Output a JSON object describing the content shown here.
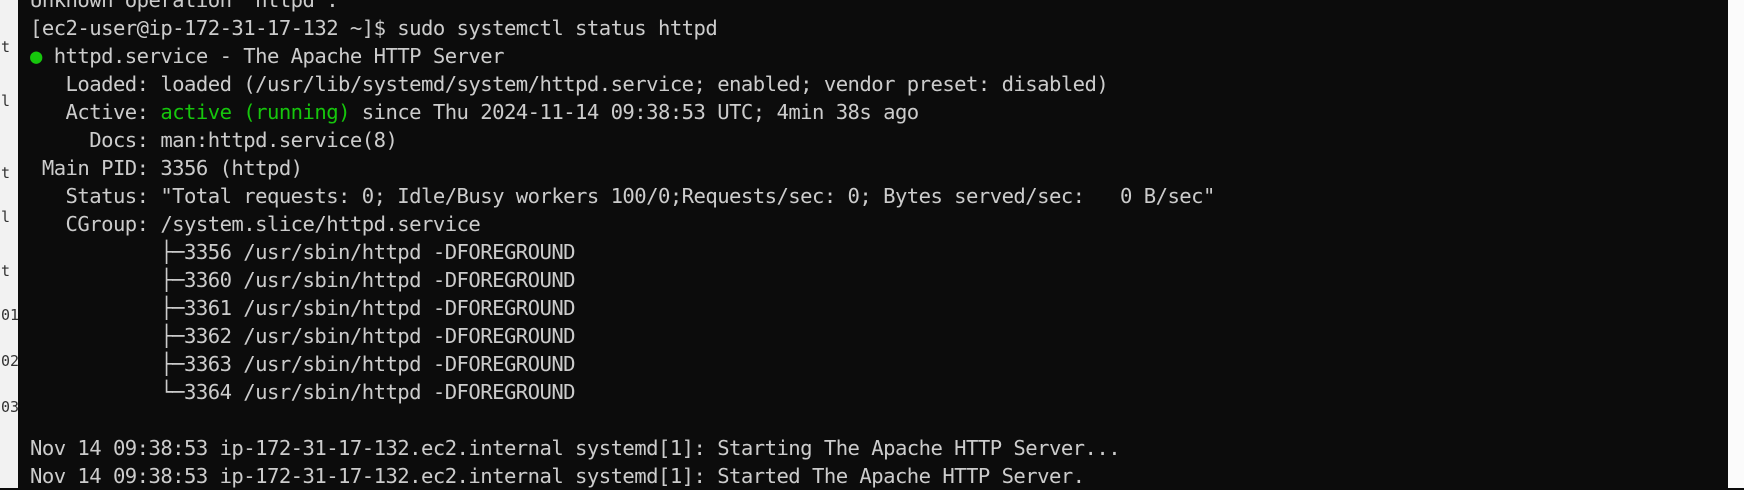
{
  "colors": {
    "background": "#0c0c0c",
    "foreground": "#cccccc",
    "active_green": "#16c60c"
  },
  "left_strip_fragments": [
    "t",
    "l",
    "t",
    "l",
    "t",
    "01",
    "02",
    "03"
  ],
  "terminal": {
    "top_partial": "Unknown operation 'httpd'.",
    "prompt": "[ec2-user@ip-172-31-17-132 ~]$ sudo systemctl status httpd",
    "status_dot": "●",
    "unit_title": " httpd.service - The Apache HTTP Server",
    "loaded": "   Loaded: loaded (/usr/lib/systemd/system/httpd.service; enabled; vendor preset: disabled)",
    "active_prefix": "   Active: ",
    "active_state": "active (running)",
    "active_suffix": " since Thu 2024-11-14 09:38:53 UTC; 4min 38s ago",
    "docs": "     Docs: man:httpd.service(8)",
    "main_pid": " Main PID: 3356 (httpd)",
    "status": "   Status: \"Total requests: 0; Idle/Busy workers 100/0;Requests/sec: 0; Bytes served/sec:   0 B/sec\"",
    "cgroup": "   CGroup: /system.slice/httpd.service",
    "processes": [
      "           ├─3356 /usr/sbin/httpd -DFOREGROUND",
      "           ├─3360 /usr/sbin/httpd -DFOREGROUND",
      "           ├─3361 /usr/sbin/httpd -DFOREGROUND",
      "           ├─3362 /usr/sbin/httpd -DFOREGROUND",
      "           ├─3363 /usr/sbin/httpd -DFOREGROUND",
      "           └─3364 /usr/sbin/httpd -DFOREGROUND"
    ],
    "blank": "",
    "log_lines": [
      "Nov 14 09:38:53 ip-172-31-17-132.ec2.internal systemd[1]: Starting The Apache HTTP Server...",
      "Nov 14 09:38:53 ip-172-31-17-132.ec2.internal systemd[1]: Started The Apache HTTP Server."
    ]
  }
}
